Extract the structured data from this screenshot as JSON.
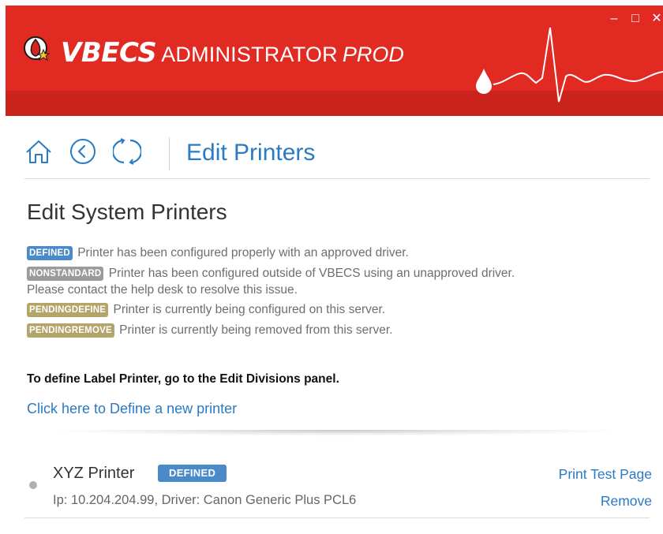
{
  "app": {
    "title_brand": "VBECS",
    "title_admin": "ADMINISTRATOR",
    "title_env": "PROD",
    "window_controls": {
      "minimize": "–",
      "maximize": "□",
      "close": "✕"
    }
  },
  "nav": {
    "title": "Edit Printers",
    "icons": [
      "home-icon",
      "back-icon",
      "refresh-icon"
    ]
  },
  "content": {
    "section_title": "Edit System Printers",
    "legend": [
      {
        "badge": "DEFINED",
        "color": "#4a8ac8",
        "text": "Printer has been configured properly with an approved driver."
      },
      {
        "badge": "NONSTANDARD",
        "color": "#9b9b9b",
        "text": "Printer has been configured outside of VBECS using an unapproved driver.",
        "continuation": "Please contact the help desk to resolve this issue."
      },
      {
        "badge": "PENDINGDEFINE",
        "color": "#b3a46a",
        "text": "Printer is currently being configured on this server."
      },
      {
        "badge": "PENDINGREMOVE",
        "color": "#b3a46a",
        "text": "Printer is currently being removed from this server."
      }
    ],
    "instruction": "To define Label Printer, go to the Edit Divisions panel.",
    "define_link": "Click here to Define a new printer"
  },
  "printers": [
    {
      "name": "XYZ Printer",
      "status": "DEFINED",
      "status_color": "#4a8ac8",
      "details": "Ip: 10.204.204.99, Driver: Canon Generic Plus PCL6",
      "actions": {
        "test": "Print Test Page",
        "remove": "Remove"
      }
    }
  ],
  "colors": {
    "banner": "#e02a22",
    "link": "#2a7ac4",
    "defined": "#4a8ac8",
    "nonstandard": "#9b9b9b",
    "pending": "#b3a46a"
  }
}
